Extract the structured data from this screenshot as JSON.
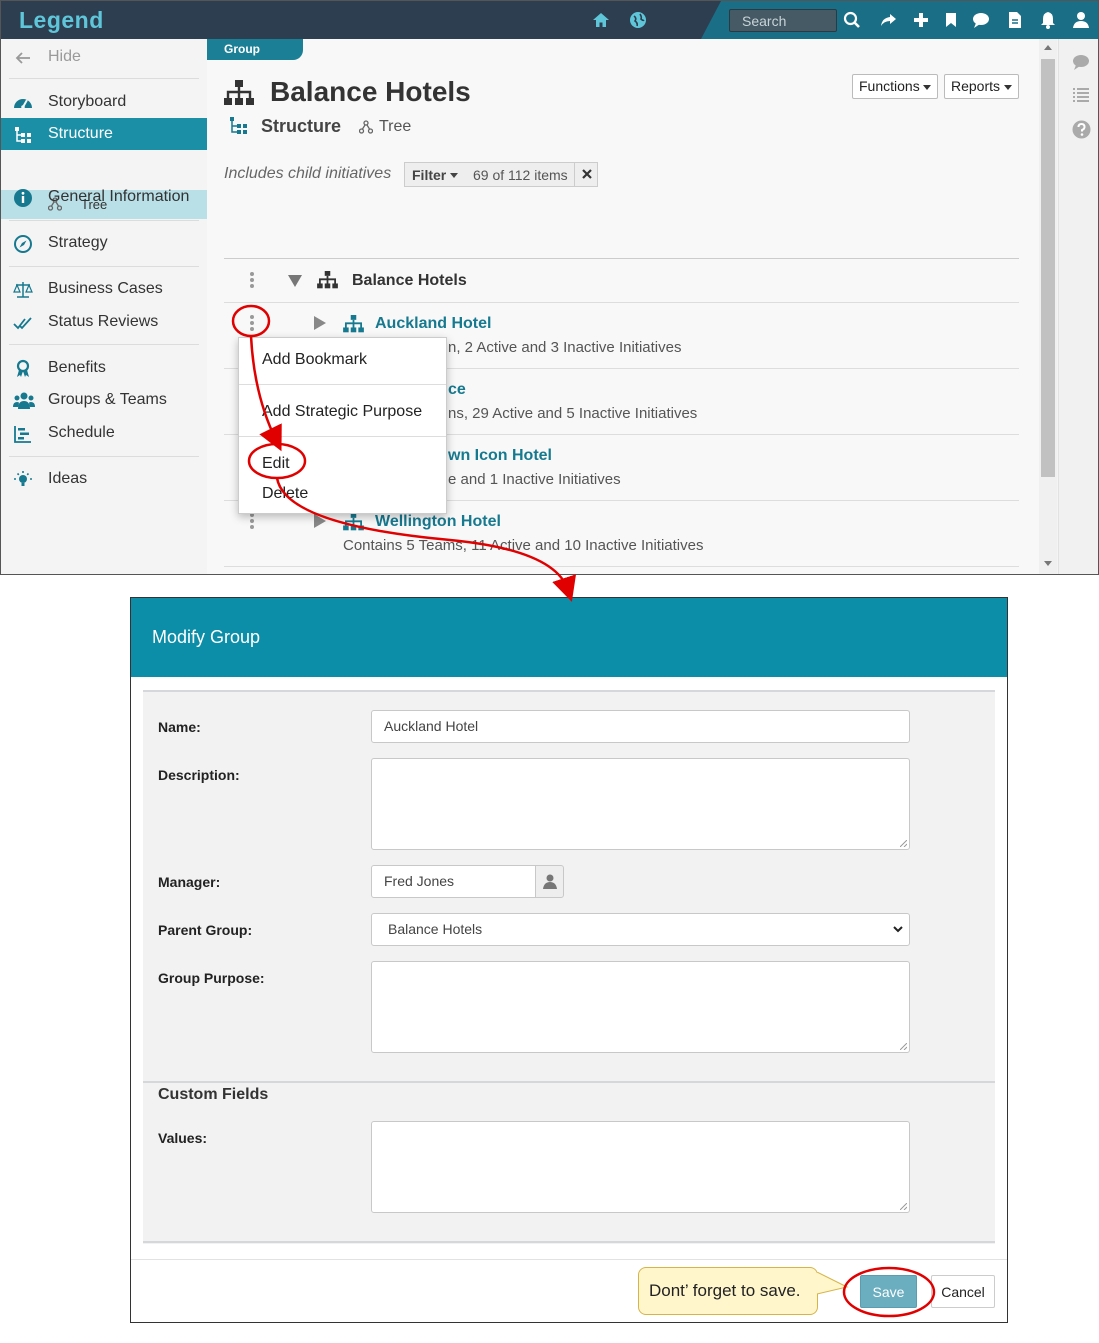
{
  "app": {
    "logo": "Legend",
    "search_placeholder": "Search",
    "icons": [
      "home-icon",
      "globe-icon",
      "search-icon",
      "share-icon",
      "plus-icon",
      "bookmark-icon",
      "comment-icon",
      "document-icon",
      "bell-icon",
      "user-icon"
    ]
  },
  "sidebar": {
    "hide_label": "Hide",
    "items": [
      {
        "label": "Storyboard",
        "icon": "dashboard-icon"
      },
      {
        "label": "Structure",
        "icon": "structure-icon",
        "active": true
      },
      {
        "label": "Tree",
        "icon": "tree-icon",
        "sub": true
      },
      {
        "label": "General Information",
        "icon": "info-icon"
      },
      {
        "label": "Strategy",
        "icon": "compass-icon"
      },
      {
        "label": "Business Cases",
        "icon": "scale-icon"
      },
      {
        "label": "Status Reviews",
        "icon": "check-icon"
      },
      {
        "label": "Benefits",
        "icon": "award-icon"
      },
      {
        "label": "Groups & Teams",
        "icon": "users-icon"
      },
      {
        "label": "Schedule",
        "icon": "schedule-icon"
      },
      {
        "label": "Ideas",
        "icon": "lightbulb-icon"
      }
    ]
  },
  "main": {
    "breadcrumb": "Group",
    "title": "Balance Hotels",
    "subtitle": "Structure",
    "tree_label": "Tree",
    "functions_btn": "Functions",
    "reports_btn": "Reports",
    "includes_text": "Includes child initiatives",
    "filter_label": "Filter",
    "filter_count": "69 of 112 items",
    "root_name": "Balance Hotels",
    "rows": [
      {
        "name": "Auckland Hotel",
        "desc": "n, 2 Active and 3 Inactive Initiatives"
      },
      {
        "name": "ce",
        "desc": "ns, 29 Active and 5 Inactive Initiatives"
      },
      {
        "name": "wn Icon Hotel",
        "desc": "e and 1 Inactive Initiatives"
      },
      {
        "name": "Wellington Hotel",
        "desc": "Contains 5 Teams, 11 Active and 10 Inactive Initiatives"
      }
    ]
  },
  "context_menu": {
    "add_bookmark": "Add Bookmark",
    "add_strategic_purpose": "Add Strategic Purpose",
    "edit": "Edit",
    "delete": "Delete"
  },
  "dialog": {
    "title": "Modify Group",
    "name_label": "Name:",
    "name_value": "Auckland Hotel",
    "description_label": "Description:",
    "manager_label": "Manager:",
    "manager_value": "Fred Jones",
    "parent_label": "Parent Group:",
    "parent_value": "Balance Hotels",
    "purpose_label": "Group Purpose:",
    "custom_fields_title": "Custom Fields",
    "values_label": "Values:",
    "save_label": "Save",
    "cancel_label": "Cancel"
  },
  "callout": {
    "text": "Dont’ forget to save."
  },
  "colors": {
    "accent": "#1b8fa6",
    "topbar": "#2c3e50",
    "link": "#17798f",
    "annotation": "#e00000"
  }
}
